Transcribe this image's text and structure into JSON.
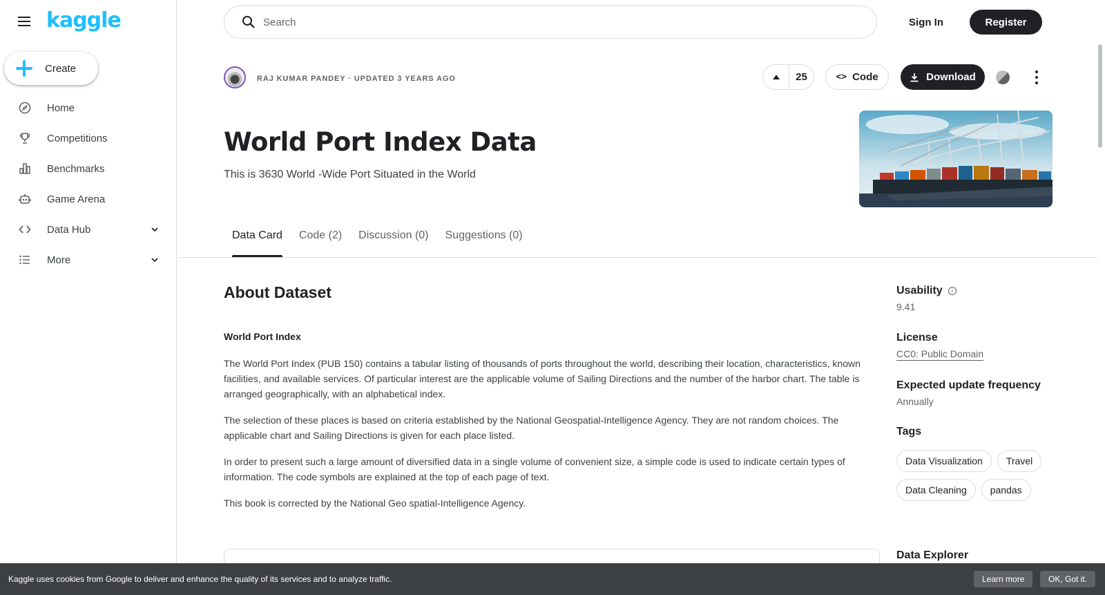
{
  "sidebar": {
    "logo": "kaggle",
    "create_label": "Create",
    "items": [
      {
        "label": "Home",
        "icon": "compass-icon"
      },
      {
        "label": "Competitions",
        "icon": "trophy-icon"
      },
      {
        "label": "Benchmarks",
        "icon": "bar-chart-icon"
      },
      {
        "label": "Game Arena",
        "icon": "robot-icon"
      },
      {
        "label": "Data Hub",
        "icon": "code-icon",
        "expandable": true
      },
      {
        "label": "More",
        "icon": "list-icon",
        "expandable": true
      }
    ]
  },
  "topbar": {
    "search_placeholder": "Search",
    "signin_label": "Sign In",
    "register_label": "Register"
  },
  "dataset": {
    "author_line": "RAJ KUMAR PANDEY · UPDATED 3 YEARS AGO",
    "votes": "25",
    "code_label": "Code",
    "download_label": "Download",
    "title": "World Port Index Data",
    "subtitle": "This is 3630 World -Wide Port Situated in the World"
  },
  "tabs": [
    {
      "label": "Data Card",
      "active": true
    },
    {
      "label": "Code (2)",
      "active": false
    },
    {
      "label": "Discussion (0)",
      "active": false
    },
    {
      "label": "Suggestions (0)",
      "active": false
    }
  ],
  "about": {
    "heading": "About Dataset",
    "subheading": "World Port Index",
    "paragraphs": [
      "The World Port Index (PUB 150) contains a tabular listing of thousands of ports throughout the world, describing their location, characteristics, known facilities, and available services. Of particular interest are the applicable volume of Sailing Directions and the number of the harbor chart. The table is arranged geographically, with an alphabetical index.",
      "The selection of these places is based on criteria established by the National Geospatial-Intelligence Agency. They are not random choices. The applicable chart and Sailing Directions is given for each place listed.",
      "In order to present such a large amount of diversified data in a single volume of convenient size, a simple code is used to indicate certain types of information. The code symbols are explained at the top of each page of text.",
      "This book is corrected by the National Geo spatial-Intelligence Agency."
    ]
  },
  "meta": {
    "usability_label": "Usability",
    "usability_value": "9.41",
    "license_label": "License",
    "license_value": "CC0: Public Domain",
    "frequency_label": "Expected update frequency",
    "frequency_value": "Annually",
    "tags_label": "Tags",
    "tags": [
      "Data Visualization",
      "Travel",
      "Data Cleaning",
      "pandas"
    ],
    "explorer_label": "Data Explorer"
  },
  "cookie": {
    "text": "Kaggle uses cookies from Google to deliver and enhance the quality of its services and to analyze traffic.",
    "learn_more": "Learn more",
    "ok": "OK, Got it."
  },
  "colors": {
    "brand": "#20beff",
    "dark": "#202124",
    "cookie_bg": "#3c4043"
  }
}
